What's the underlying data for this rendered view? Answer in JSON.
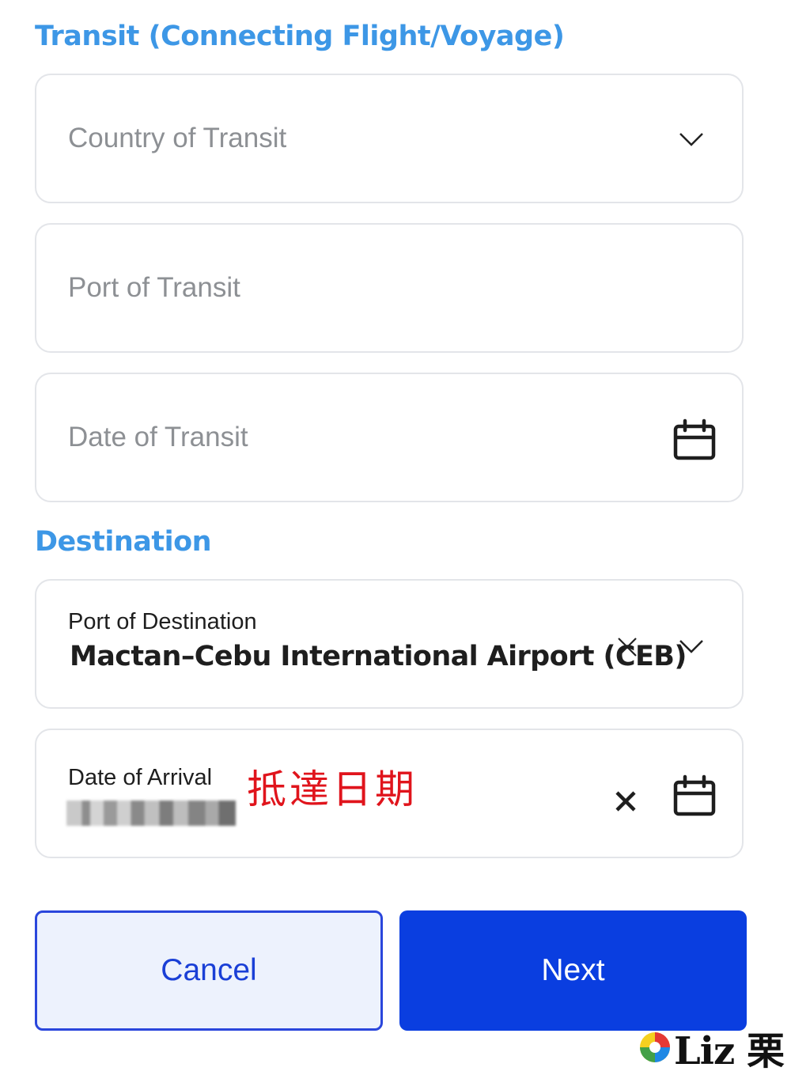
{
  "transit": {
    "section_title": "Transit (Connecting Flight/Voyage)",
    "country_placeholder": "Country of Transit",
    "port_placeholder": "Port of Transit",
    "date_placeholder": "Date of Transit"
  },
  "destination": {
    "section_title": "Destination",
    "port_label": "Port of Destination",
    "port_value": "Mactan–Cebu International Airport (CEB)",
    "arrival_label": "Date of Arrival",
    "arrival_annotation": "抵達日期"
  },
  "buttons": {
    "cancel_label": "Cancel",
    "next_label": "Next"
  },
  "watermark": {
    "text": "Liz 栗"
  },
  "colors": {
    "section_title": "#3d97e6",
    "primary": "#0a3ee0",
    "cancel_bg": "#edf2fd",
    "annotation": "#e0141c"
  },
  "icons": {
    "dropdown": "chevron-down-icon",
    "calendar": "calendar-icon",
    "clear": "close-icon"
  }
}
